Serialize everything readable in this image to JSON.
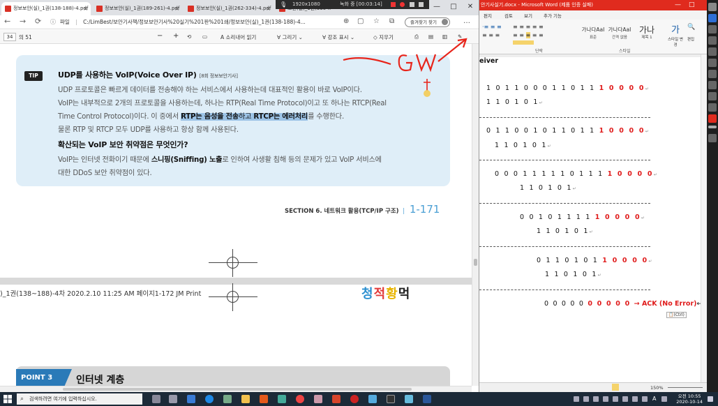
{
  "browser": {
    "tabs": [
      {
        "label": "정보보안(실)_1권(138-188)-4.pdf",
        "active": true
      },
      {
        "label": "정보보안(실)_1권(189-261)-4.pdf",
        "active": false
      },
      {
        "label": "정보보안(실)_1권(262-334)-4.pdf",
        "active": false
      },
      {
        "label": "보안(실)_1권(335-...)-4.pdf",
        "active": false
      }
    ],
    "tab_close": "×",
    "recording": {
      "resolution": "1920x1080",
      "time": "녹화 중 [00:03:14]"
    },
    "window_controls": {
      "minimize": "—",
      "maximize": "□",
      "close": "✕"
    },
    "nav": {
      "back": "←",
      "forward": "→",
      "reload": "⟳",
      "info": "ⓘ"
    },
    "address": {
      "scheme": "파일",
      "path": "C:/LimBest/보안기사책/정보보안기사%20실기%201판%201쇄/정보보안(실)_1권(138-188)-4..."
    },
    "favorites_button": "즐겨찾기 찾기",
    "more": "…",
    "toolbar": {
      "page_input": "34",
      "page_total": "의 51",
      "zoom_out": "−",
      "zoom_in": "+",
      "read_aloud": "소리내어 읽기",
      "draw": "그리기",
      "highlight": "강조 표시",
      "erase": "지우기"
    }
  },
  "pdf": {
    "tip_badge": "TIP",
    "tip_title": "UDP를 사용하는 VoIP(Voice Over IP)",
    "tip_source": "[8회 정보보안기사]",
    "tip_para1": "UDP 프로토콜은 빠르게 데이터를 전송해야 하는 서비스에서 사용하는데 대표적인 활용이 바로 VoIP이다.",
    "tip_para2": "VoIP는 내부적으로 2개의 프로토콜을 사용하는데, 하나는 RTP(Real Time Protocol)이고 또 하나는 RTCP(Real",
    "tip_para3_a": "Time Control Protocol)이다. 이 중에서 ",
    "tip_para3_hl1": "RTP는 음성을 전송",
    "tip_para3_b": "하고 ",
    "tip_para3_hl2": "RTCP는 에러처리",
    "tip_para3_c": "를 수행한다.",
    "tip_para4": "물론 RTP 및 RTCP 모두 UDP를 사용하고 항상 함께 사용된다.",
    "sub_title": "확산되는 VoIP 보안 취약점은 무엇인가?",
    "sub_para1_a": "VoIP는 인터넷 전화이기 때문에 ",
    "sub_para1_b": "스니핑(Sniffing) 노출",
    "sub_para1_c": "로 인하여 사생활 침해 등의 문제가 있고 VoIP 서비스에",
    "sub_para2": "대한 DDoS 보안 취약점이 있다.",
    "section_label": "SECTION 6. 네트워크 활용(TCP/IP 구조)",
    "section_sep": "|",
    "page_number": "1-171",
    "print_info": ")_1권(138~188)-4차   2020.2.10 11:25 AM   페이지1-172   JM Print",
    "brand_logo": "청적황먹",
    "point_badge": "POINT 3",
    "point_title": "인터넷 계층",
    "annotation": "GW"
  },
  "word": {
    "title": "안기사실기.docx - Microsoft Word (제품 인증 실패)",
    "window_controls": {
      "minimize": "—",
      "maximize": "□",
      "close": "✕"
    },
    "menu": [
      "편지",
      "검토",
      "보기",
      "추가 기능"
    ],
    "ribbon_group_para": "단락",
    "ribbon_group_style": "스타일",
    "styles": [
      {
        "sample": "가나다AaI",
        "name": "표준"
      },
      {
        "sample": "가나다AaI",
        "name": "간격 없음"
      },
      {
        "sample": "가나",
        "name": "제목 1"
      }
    ],
    "style_change": "스타일 변경",
    "edit": "편집",
    "doc_partial_word": "eiver",
    "blocks": [
      {
        "black": "1 0 1 1 0 0 0 1 1 0 1 1",
        "red": "1 0 0 0 0",
        "divisor": "1 1 0 1 0 1"
      },
      {
        "black": "0 1 1 0 0 1 0 1 1 0 1 1",
        "red": "1 0 0 0 0",
        "divisor": "1 1 0 1 0 1"
      },
      {
        "black": "0 0 0 1 1 1 1 1 0 1 1 1",
        "red": "1 0 0 0 0",
        "divisor": "1 1 0 1 0 1"
      },
      {
        "black": "0 0 1 0 1 1 1 1",
        "red": "1 0 0 0 0",
        "divisor": "1 1 0 1 0 1"
      },
      {
        "black": "0 1 1 0 1 0 1",
        "red": "1 0 0 0 0",
        "divisor": "1 1 0 1 0 1"
      }
    ],
    "final_black": "0 0 0 0 0",
    "final_red": "0 0 0 0 0",
    "ack_text": "→ ACK (No Error)",
    "paragraph_mark": "↵",
    "paste_popup": "(Ctrl)",
    "zoom": "150%"
  },
  "taskbar": {
    "search_placeholder": "검색하려면 여기에 입력하십시오.",
    "tray_time": "오전 10:55",
    "tray_date": "2020-10-14",
    "ime": "A"
  },
  "colors": {
    "accent_blue": "#4a9fd4",
    "tip_bg": "#dfeef8",
    "highlight": "#9cc3e6",
    "word_red": "#e01b1b",
    "title_red": "#e02b1e",
    "annotation_red": "#e8241a"
  }
}
